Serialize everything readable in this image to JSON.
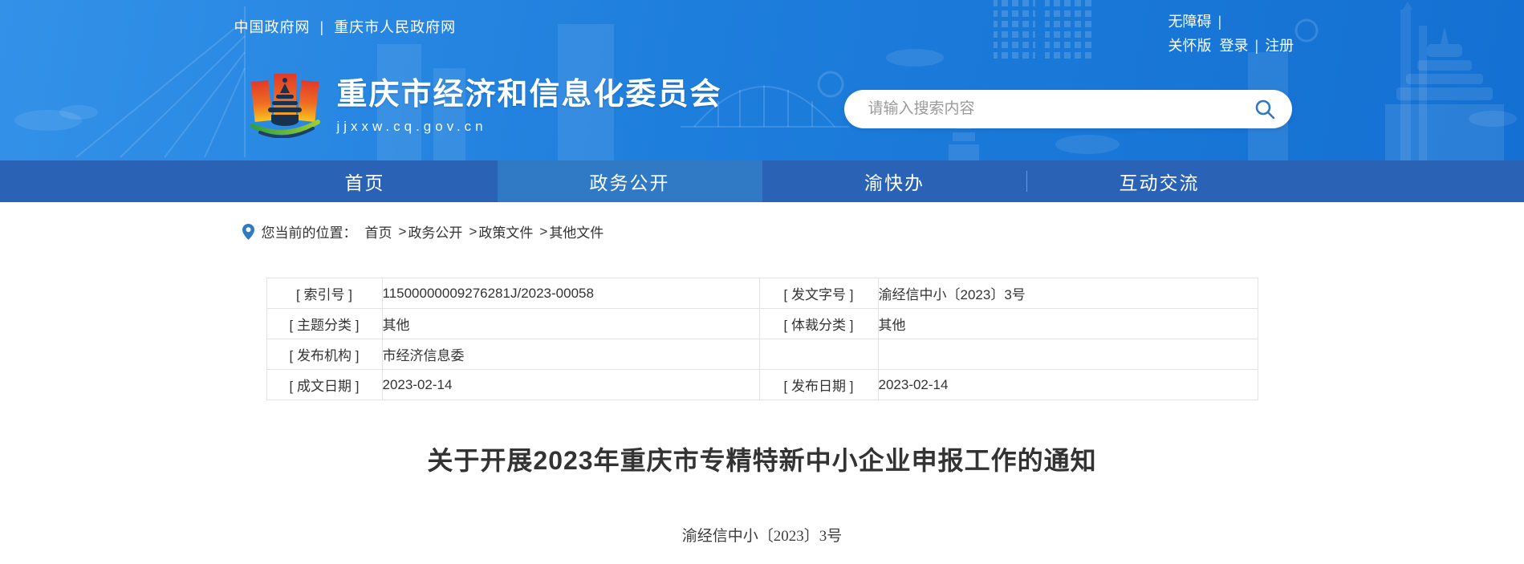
{
  "colors": {
    "header_blue": "#1e7edc",
    "header_blue_light": "#3391e8",
    "nav_blue": "#2a62b5",
    "nav_active_blue": "#3079c4",
    "accent_blue": "#2f7ac5",
    "logo_red": "#e03a2a",
    "logo_yellow": "#f6c51f",
    "logo_green": "#3aa33a",
    "text_dark": "#333333",
    "placeholder_gray": "#9a9a9a",
    "table_border": "#e3e3e3"
  },
  "separators": {
    "pipe": "|"
  },
  "header": {
    "gov_links": [
      {
        "label": "中国政府网"
      },
      {
        "label": "重庆市人民政府网"
      }
    ],
    "utility": {
      "accessibility": "无障碍",
      "care_version": "关怀版",
      "login": "登录",
      "register": "注册"
    },
    "site_name": "重庆市经济和信息化委员会",
    "site_url": "jjxxw.cq.gov.cn",
    "search": {
      "placeholder": "请输入搜索内容",
      "icon": "search-icon"
    }
  },
  "nav": {
    "active_index": 1,
    "items": [
      {
        "label": "首页"
      },
      {
        "label": "政务公开"
      },
      {
        "label": "渝快办"
      },
      {
        "label": "互动交流"
      }
    ]
  },
  "breadcrumb": {
    "prefix": "您当前的位置：",
    "separator": ">",
    "icon": "location-pin-icon",
    "items": [
      {
        "label": "首页"
      },
      {
        "label": "政务公开"
      },
      {
        "label": "政策文件"
      },
      {
        "label": "其他文件"
      }
    ]
  },
  "doc_meta": {
    "rows": [
      {
        "label1": "[ 索引号 ]",
        "value1": "11500000009276281J/2023-00058",
        "label2": "[ 发文字号 ]",
        "value2": "渝经信中小〔2023〕3号"
      },
      {
        "label1": "[ 主题分类 ]",
        "value1": "其他",
        "label2": "[ 体裁分类 ]",
        "value2": "其他"
      },
      {
        "label1": "[ 发布机构 ]",
        "value1": "市经济信息委",
        "label2": "",
        "value2": ""
      },
      {
        "label1": "[ 成文日期 ]",
        "value1": "2023-02-14",
        "label2": "[ 发布日期 ]",
        "value2": "2023-02-14"
      }
    ]
  },
  "article": {
    "title": "关于开展2023年重庆市专精特新中小企业申报工作的通知",
    "doc_number": "渝经信中小〔2023〕3号"
  }
}
